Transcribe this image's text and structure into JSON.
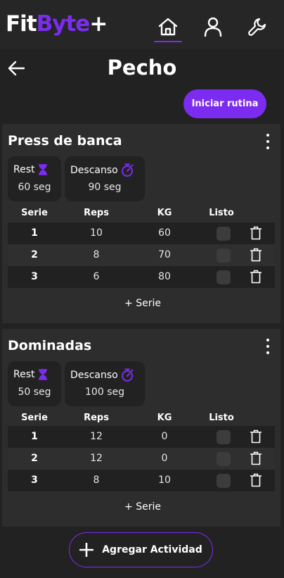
{
  "app": {
    "logo_white": "Fit",
    "logo_purple": "Byte",
    "logo_plus": "+",
    "accent_color": "#7c2cf1"
  },
  "nav": {
    "items": [
      {
        "icon": "home-icon",
        "active": true
      },
      {
        "icon": "user-icon",
        "active": false
      },
      {
        "icon": "wrench-icon",
        "active": false
      }
    ]
  },
  "page": {
    "title": "Pecho",
    "start_button": "Iniciar rutina",
    "add_activity_button": "Agregar Actividad"
  },
  "table_headers": {
    "serie": "Serie",
    "reps": "Reps",
    "kg": "KG",
    "listo": "Listo"
  },
  "exercises": [
    {
      "name": "Press de banca",
      "rest_label": "Rest",
      "rest_value": "60 seg",
      "descanso_label": "Descanso",
      "descanso_value": "90 seg",
      "add_series": "+ Serie",
      "sets": [
        {
          "serie": "1",
          "reps": "10",
          "kg": "60",
          "done": false
        },
        {
          "serie": "2",
          "reps": "8",
          "kg": "70",
          "done": false
        },
        {
          "serie": "3",
          "reps": "6",
          "kg": "80",
          "done": false
        }
      ]
    },
    {
      "name": "Dominadas",
      "rest_label": "Rest",
      "rest_value": "50 seg",
      "descanso_label": "Descanso",
      "descanso_value": "100 seg",
      "add_series": "+ Serie",
      "sets": [
        {
          "serie": "1",
          "reps": "12",
          "kg": "0",
          "done": false
        },
        {
          "serie": "2",
          "reps": "12",
          "kg": "0",
          "done": false
        },
        {
          "serie": "3",
          "reps": "8",
          "kg": "10",
          "done": false
        }
      ]
    }
  ]
}
